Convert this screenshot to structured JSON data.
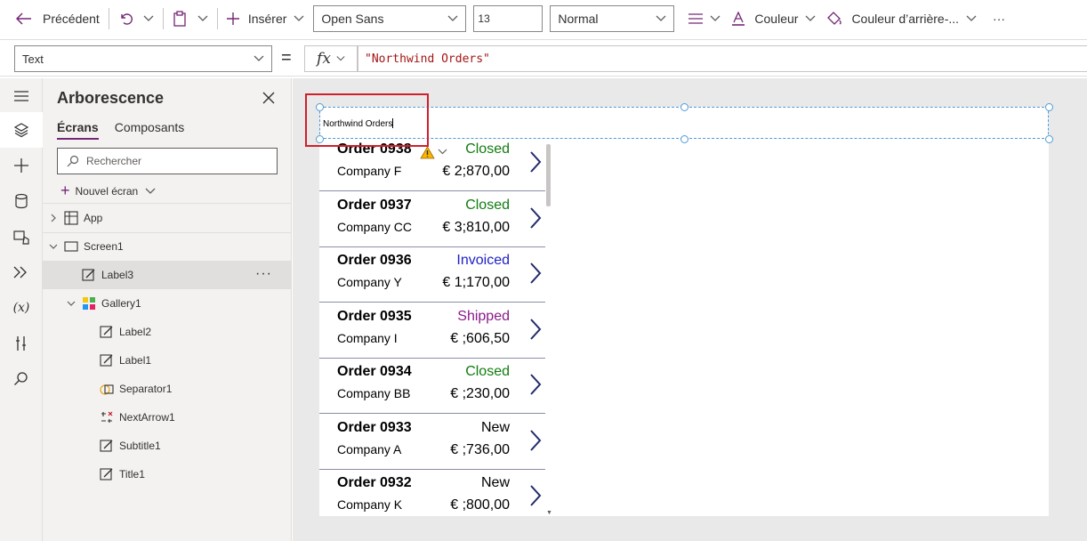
{
  "toolbar": {
    "back_label": "Précédent",
    "insert_label": "Insérer",
    "font_family": "Open Sans",
    "font_size": "13",
    "font_weight": "Normal",
    "color_label": "Couleur",
    "bg_color_label": "Couleur d’arrière-...",
    "more_label": "···"
  },
  "formula_bar": {
    "property": "Text",
    "equals": "=",
    "fx": "fx",
    "formula": "\"Northwind Orders\""
  },
  "tree": {
    "title": "Arborescence",
    "tabs": [
      "Écrans",
      "Composants"
    ],
    "search_placeholder": "Rechercher",
    "new_screen_label": "Nouvel écran",
    "nodes": {
      "app": "App",
      "screen1": "Screen1",
      "label3": "Label3",
      "gallery1": "Gallery1",
      "label2": "Label2",
      "label1": "Label1",
      "separator1": "Separator1",
      "nextarrow1": "NextArrow1",
      "subtitle1": "Subtitle1",
      "title1": "Title1"
    },
    "more": "···"
  },
  "canvas": {
    "label_text": "Northwind Orders",
    "orders": [
      {
        "title": "Order 0938",
        "company": "Company F",
        "status": "Closed",
        "price": "€ 2;870,00",
        "status_color": "#107c10"
      },
      {
        "title": "Order 0937",
        "company": "Company CC",
        "status": "Closed",
        "price": "€ 3;810,00",
        "status_color": "#107c10"
      },
      {
        "title": "Order 0936",
        "company": "Company Y",
        "status": "Invoiced",
        "price": "€ 1;170,00",
        "status_color": "#2020c8"
      },
      {
        "title": "Order 0935",
        "company": "Company I",
        "status": "Shipped",
        "price": "€ ;606,50",
        "status_color": "#8a1a8a"
      },
      {
        "title": "Order 0934",
        "company": "Company BB",
        "status": "Closed",
        "price": "€ ;230,00",
        "status_color": "#107c10"
      },
      {
        "title": "Order 0933",
        "company": "Company A",
        "status": "New",
        "price": "€ ;736,00",
        "status_color": "#000000"
      },
      {
        "title": "Order 0932",
        "company": "Company K",
        "status": "New",
        "price": "€ ;800,00",
        "status_color": "#000000"
      }
    ]
  },
  "colors": {
    "accent": "#742774",
    "selection": "#4f9bd9",
    "highlight": "#d0202c"
  }
}
